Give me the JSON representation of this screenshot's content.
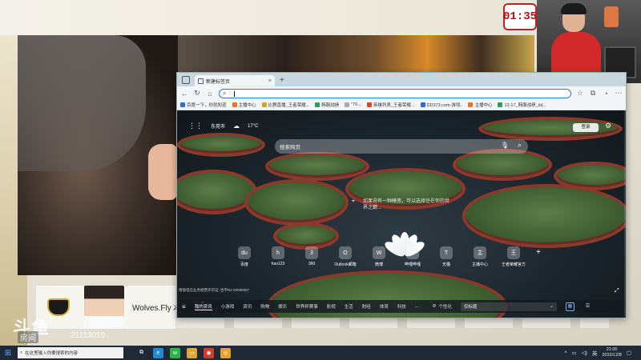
{
  "stream": {
    "timer": "01:35",
    "player_name": "Wolves.Fly",
    "platform_logo": "斗鱼",
    "room_label": "房间",
    "room_number": "21113010"
  },
  "browser": {
    "tab_title": "新建标签页",
    "tab_close": "×",
    "new_tab": "+",
    "address_value": "",
    "bookmarks": [
      {
        "label": "百度一下，你就知道",
        "color": "#2f6fd8"
      },
      {
        "label": "主播中心",
        "color": "#e07a2a"
      },
      {
        "label": "比赛直播_王者荣耀...",
        "color": "#d6a52a"
      },
      {
        "label": "韩服战绩",
        "color": "#2aa05a"
      },
      {
        "label": "\"70...",
        "color": "#aaaaaa"
      },
      {
        "label": "英雄列表_王者荣耀...",
        "color": "#d64a2a"
      },
      {
        "label": "DD373.com-游戏..",
        "color": "#2a6ad6"
      },
      {
        "label": "主播中心",
        "color": "#e07a2a"
      },
      {
        "label": "12-17_韩服战绩_lol...",
        "color": "#2aa05a"
      }
    ]
  },
  "newtab": {
    "city": "东莞市",
    "temperature": "17°C",
    "login_label": "登录",
    "search_placeholder": "搜索网页",
    "info_text": "如果说有一种睡莲，可以选择住在你的世界之巅...",
    "quicklinks": [
      {
        "label": "百度",
        "glyph": "du"
      },
      {
        "label": "hao123",
        "glyph": "h"
      },
      {
        "label": "360",
        "glyph": "3"
      },
      {
        "label": "Outlook邮箱",
        "glyph": "O"
      },
      {
        "label": "微博",
        "glyph": "W"
      },
      {
        "label": "哔哩哔哩",
        "glyph": "B"
      },
      {
        "label": "天猫",
        "glyph": "T"
      },
      {
        "label": "主播中心",
        "glyph": "主"
      },
      {
        "label": "王者荣耀官方",
        "glyph": "王"
      }
    ],
    "add_label": "+",
    "icp": "增值电信业务经营许可证: 合字B2-20090007",
    "feed_items": [
      "我的资讯",
      "小游戏",
      "资讯",
      "购物",
      "娱乐",
      "世界杯赛事",
      "影视",
      "生活",
      "财经",
      "体育",
      "科技",
      "..."
    ],
    "personalize": "个性化",
    "select_value": "仅标题"
  },
  "taskbar": {
    "search_placeholder": "在这里输入你要搜索的内容",
    "time": "21:00",
    "date": "2022/12/8",
    "icons": [
      {
        "name": "task-view-icon",
        "glyph": "⧉",
        "color": "transparent"
      },
      {
        "name": "edge-icon",
        "glyph": "e",
        "color": "#1c8ad8"
      },
      {
        "name": "wechat-icon",
        "glyph": "w",
        "color": "#2ab54a"
      },
      {
        "name": "explorer-icon",
        "glyph": "▭",
        "color": "#e0a830"
      },
      {
        "name": "app-icon",
        "glyph": "◉",
        "color": "#d83a2a"
      },
      {
        "name": "chrome-icon",
        "glyph": "◎",
        "color": "#e8a020"
      }
    ]
  },
  "colors": {
    "accent": "#2a7bd8",
    "taskbar": "#1f2a36",
    "pad_rim": "#8a3a2c"
  }
}
